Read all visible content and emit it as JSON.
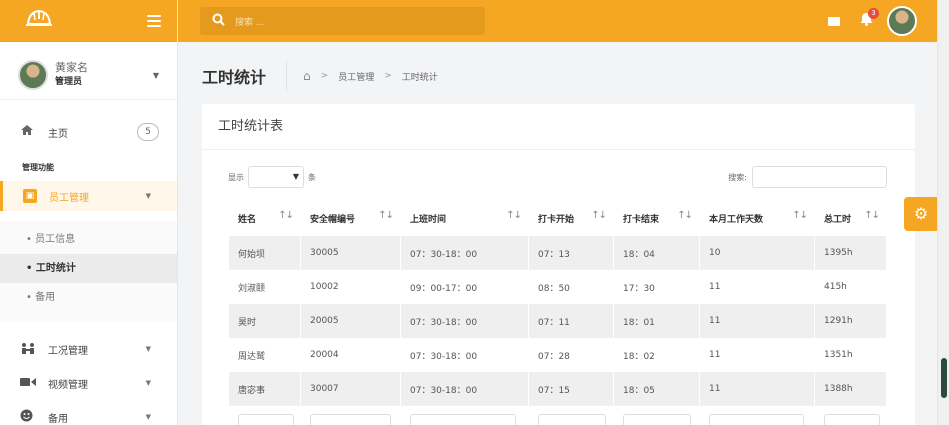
{
  "sidebar": {
    "user": {
      "name": "黄家名",
      "role": "管理员"
    },
    "home": {
      "label": "主页",
      "badge": "5"
    },
    "section_title": "管理功能",
    "active_group": {
      "label": "员工管理"
    },
    "sub_items": [
      {
        "label": "员工信息"
      },
      {
        "label": "工时统计"
      },
      {
        "label": "备用"
      }
    ],
    "items": [
      {
        "label": "工况管理"
      },
      {
        "label": "视频管理"
      },
      {
        "label": "备用"
      }
    ]
  },
  "topbar": {
    "search_placeholder": "搜索 ...",
    "notification_count": "3"
  },
  "page": {
    "title": "工时统计",
    "breadcrumb": [
      "员工管理",
      "工时统计"
    ]
  },
  "card": {
    "title": "工时统计表",
    "show_label": "显示",
    "unit_label": "条",
    "search_label": "搜索:"
  },
  "table": {
    "columns": [
      "姓名",
      "安全帽编号",
      "上班时间",
      "打卡开始",
      "打卡结束",
      "本月工作天数",
      "总工时"
    ],
    "rows": [
      [
        "何始坝",
        "30005",
        "07：30-18：00",
        "07：13",
        "18：04",
        "10",
        "1395h"
      ],
      [
        "刘淑颐",
        "10002",
        "09：00-17：00",
        "08：50",
        "17：30",
        "11",
        "415h"
      ],
      [
        "昊时",
        "20005",
        "07：30-18：00",
        "07：11",
        "18：01",
        "11",
        "1291h"
      ],
      [
        "周达鹫",
        "20004",
        "07：30-18：00",
        "07：28",
        "18：02",
        "11",
        "1351h"
      ],
      [
        "唐宓事",
        "30007",
        "07：30-18：00",
        "07：15",
        "18：05",
        "11",
        "1388h"
      ]
    ]
  },
  "colors": {
    "accent": "#f5a623",
    "accent_dark": "#e49a1d",
    "alert": "#e74c3c"
  }
}
